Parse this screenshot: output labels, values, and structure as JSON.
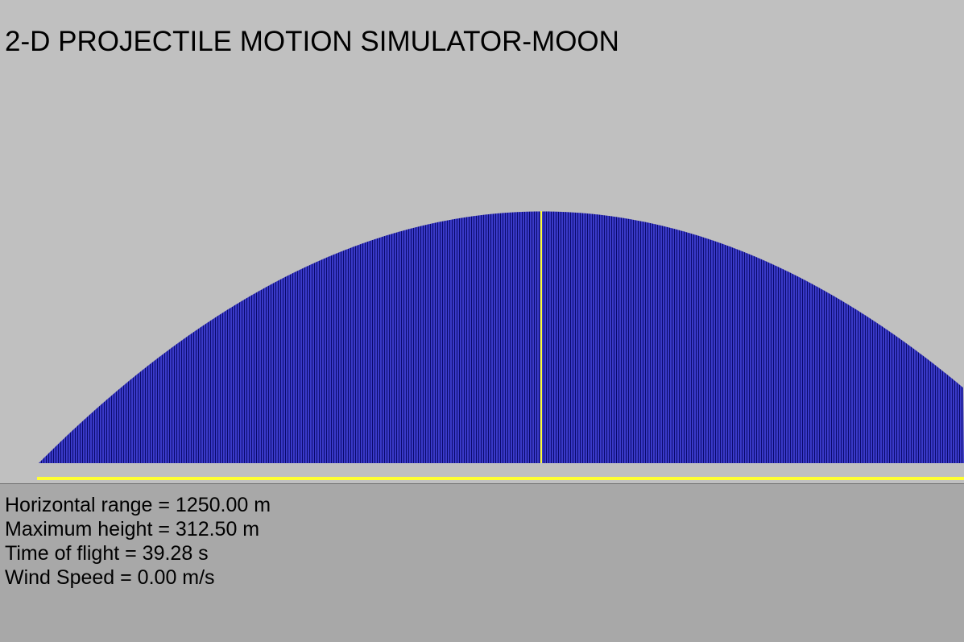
{
  "window": {
    "title": "2-D PROJECTILE MOTION SIMULATOR-MOON"
  },
  "colors": {
    "background": "#c0c0c0",
    "results_panel": "#a8a8a8",
    "trajectory_fill": "#3a3ac8",
    "trajectory_stripe": "#0a0a6e",
    "ground_line": "#ffff33",
    "apex_marker": "#ffff33"
  },
  "simulation": {
    "range_m": 1250.0,
    "max_height_m": 312.5,
    "time_of_flight_s": 39.28,
    "wind_speed_mps": 0.0
  },
  "results": {
    "range_text": "Horizontal range = 1250.00 m",
    "height_text": "Maximum height = 312.50 m",
    "time_text": "Time of flight = 39.28 s",
    "wind_text": "Wind Speed = 0.00 m/s"
  }
}
